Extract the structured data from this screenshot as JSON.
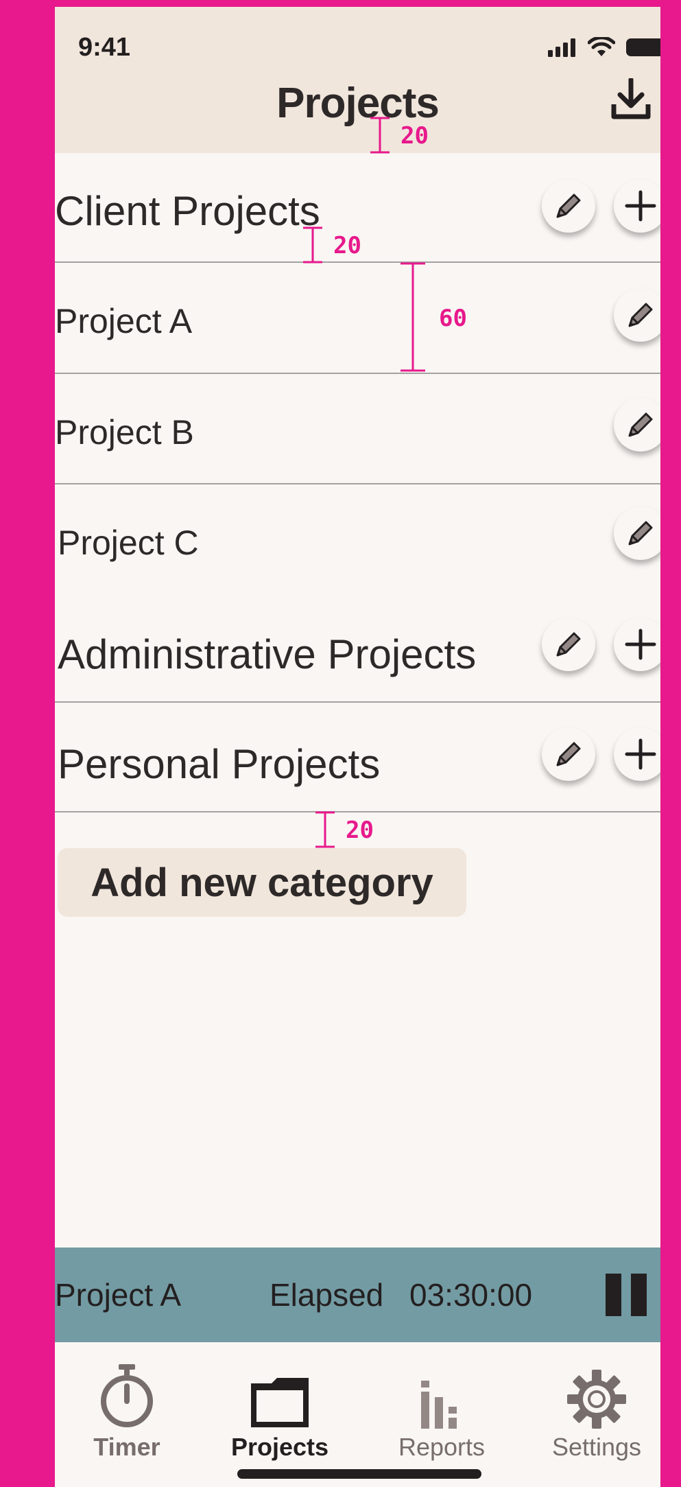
{
  "status_bar": {
    "time": "9:41"
  },
  "header": {
    "title": "Projects",
    "download_icon": "download-icon"
  },
  "annotations": {
    "top_gap": "20",
    "category_gap": "20",
    "row_height": "60",
    "button_gap": "20"
  },
  "categories": [
    {
      "label": "Client Projects",
      "projects": [
        "Project A",
        "Project B",
        "Project C"
      ]
    },
    {
      "label": "Administrative Projects",
      "projects": []
    },
    {
      "label": "Personal Projects",
      "projects": []
    }
  ],
  "add_category_label": "Add new category",
  "timer_bar": {
    "project": "Project A",
    "elapsed_label": "Elapsed",
    "elapsed_value": "03:30:00"
  },
  "tabs": [
    {
      "label": "Timer",
      "icon": "stopwatch-icon",
      "state": "inactive"
    },
    {
      "label": "Projects",
      "icon": "folder-icon",
      "state": "active"
    },
    {
      "label": "Reports",
      "icon": "bar-chart-icon",
      "state": "inactive"
    },
    {
      "label": "Settings",
      "icon": "gear-icon",
      "state": "inactive"
    }
  ],
  "colors": {
    "frame": "#e7198c",
    "header_bg": "#f1e6dc",
    "screen_bg": "#f9f6f3",
    "timer_bar_bg": "#739ba3",
    "text": "#2e2929",
    "icon_gray": "#938886",
    "inactive_tab": "#766d6c",
    "annotation": "#e7198c"
  }
}
